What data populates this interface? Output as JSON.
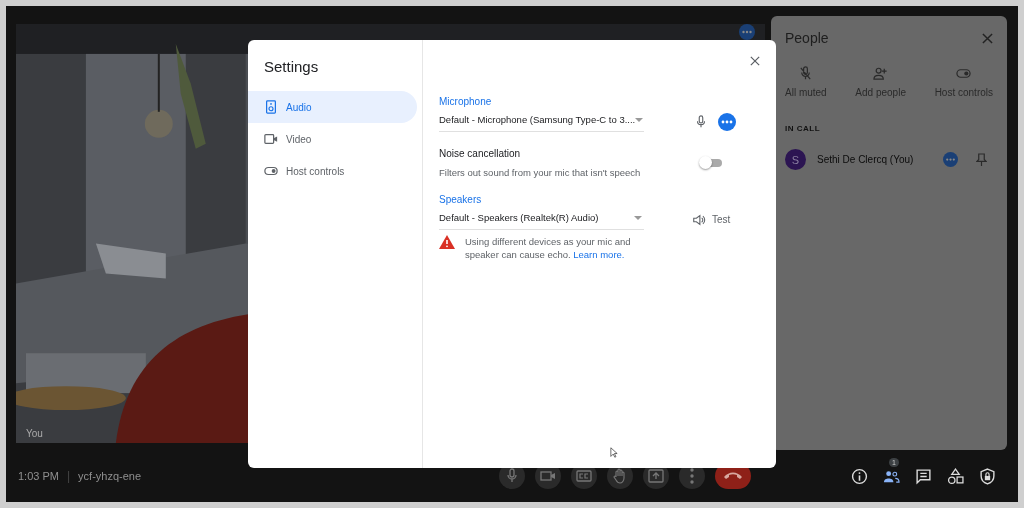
{
  "video": {
    "label": "You"
  },
  "people_panel": {
    "title": "People",
    "actions": [
      {
        "label": "All muted"
      },
      {
        "label": "Add people"
      },
      {
        "label": "Host controls"
      }
    ],
    "section": "IN CALL",
    "participants": [
      {
        "initial": "S",
        "name": "Sethi De Clercq (You)"
      }
    ]
  },
  "bottom_bar": {
    "time": "1:03 PM",
    "separator": "|",
    "meeting_code": "ycf-yhzq-ene",
    "people_badge": "1"
  },
  "settings": {
    "title": "Settings",
    "nav": [
      {
        "label": "Audio",
        "selected": true
      },
      {
        "label": "Video",
        "selected": false
      },
      {
        "label": "Host controls",
        "selected": false
      }
    ],
    "microphone": {
      "label": "Microphone",
      "value": "Default - Microphone (Samsung Type-C to 3...."
    },
    "noise_cancellation": {
      "label": "Noise cancellation",
      "description": "Filters out sound from your mic that isn't speech",
      "on": false
    },
    "speakers": {
      "label": "Speakers",
      "value": "Default - Speakers (Realtek(R) Audio)",
      "test": "Test"
    },
    "warning": {
      "text": "Using different devices as your mic and speaker can cause echo.",
      "link": "Learn more."
    }
  }
}
